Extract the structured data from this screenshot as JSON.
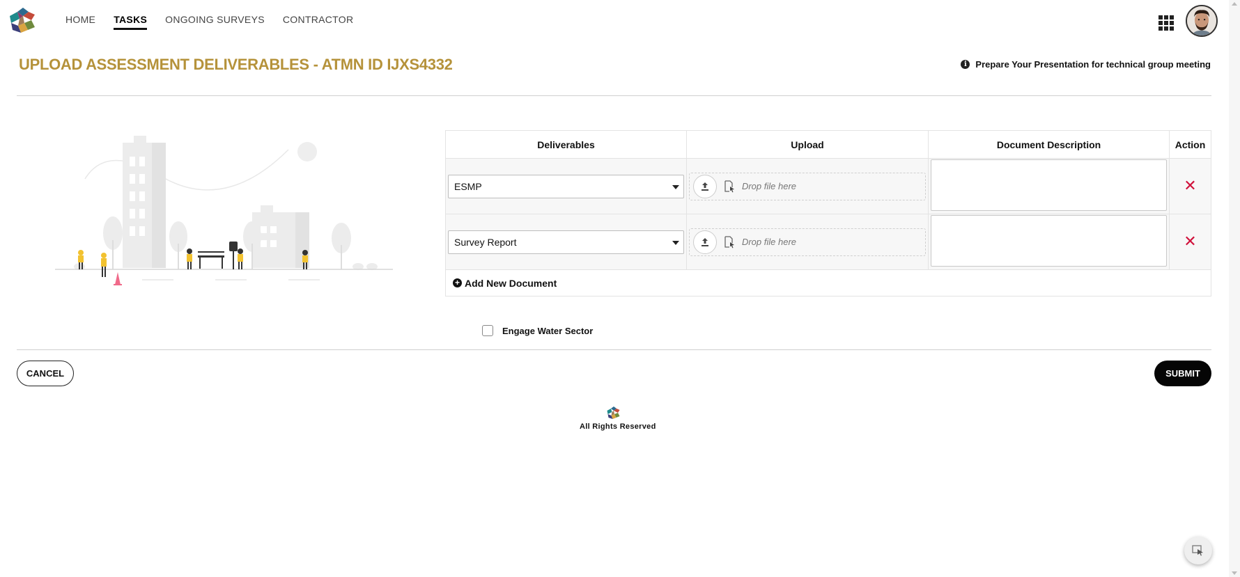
{
  "header": {
    "nav": [
      {
        "label": "HOME",
        "active": false
      },
      {
        "label": "TASKS",
        "active": true
      },
      {
        "label": "ONGOING SURVEYS",
        "active": false
      },
      {
        "label": "CONTRACTOR",
        "active": false
      }
    ],
    "apps_icon": "grid-icon",
    "avatar_icon": "user-avatar"
  },
  "page": {
    "title": "UPLOAD ASSESSMENT DELIVERABLES - ATMN ID IJXS4332",
    "info_note": "Prepare Your Presentation for technical group meeting",
    "title_color": "#b5923a"
  },
  "table": {
    "headers": {
      "deliverables": "Deliverables",
      "upload": "Upload",
      "description": "Document Description",
      "action": "Action"
    },
    "rows": [
      {
        "deliverable": "ESMP",
        "drop_text": "Drop file here",
        "description": ""
      },
      {
        "deliverable": "Survey Report",
        "drop_text": "Drop file here",
        "description": ""
      }
    ],
    "add_label": "Add New Document"
  },
  "engage": {
    "label": "Engage Water Sector",
    "checked": false
  },
  "actions": {
    "cancel": "CANCEL",
    "submit": "SUBMIT"
  },
  "footer": {
    "text": "All Rights Reserved"
  },
  "colors": {
    "accent": "#b5923a",
    "delete": "#d0103a",
    "primary": "#050505"
  }
}
